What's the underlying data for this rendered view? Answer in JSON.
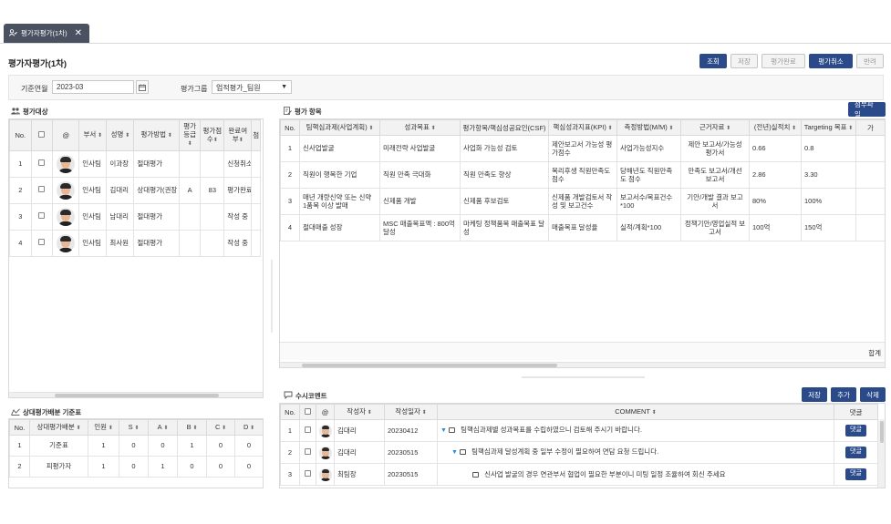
{
  "tab": {
    "label": "평가자평가(1차)",
    "close": "✕"
  },
  "page": {
    "title": "평가자평가(1차)"
  },
  "toolbar": {
    "search": "조회",
    "save": "저장",
    "complete": "평가완료",
    "cancel": "평가취소",
    "reject": "반려"
  },
  "filters": {
    "month_label": "기준연월",
    "month_value": "2023-03",
    "group_label": "평가그룹",
    "group_value": "업적평가_팀원"
  },
  "targets": {
    "title": "평가대상",
    "headers": [
      "No.",
      "",
      "@",
      "부서",
      "성명",
      "평가방법",
      "평가등급",
      "평가점수",
      "완료여부",
      "첨"
    ],
    "rows": [
      {
        "no": "1",
        "dept": "인사팀",
        "name": "이과장",
        "method": "절대평가",
        "grade": "",
        "score": "",
        "status": "신청취소"
      },
      {
        "no": "2",
        "dept": "인사팀",
        "name": "김대리",
        "method": "상대평가(권장",
        "grade": "A",
        "score": "83",
        "status": "평가완료"
      },
      {
        "no": "3",
        "dept": "인사팀",
        "name": "남대리",
        "method": "절대평가",
        "grade": "",
        "score": "",
        "status": "작성 중"
      },
      {
        "no": "4",
        "dept": "인사팀",
        "name": "최사원",
        "method": "절대평가",
        "grade": "",
        "score": "",
        "status": "작성 중"
      }
    ]
  },
  "items": {
    "title": "평가 항목",
    "attach": "첨부파일",
    "headers": [
      "No.",
      "팀핵심과제(사업계획)",
      "성과목표",
      "평가항목/핵심성공요인(CSF)",
      "핵심성과지표(KPI)",
      "측정방법(M/M)",
      "근거자료",
      "(전년)실적치",
      "Targeting 목표",
      "가"
    ],
    "rows": [
      {
        "no": "1",
        "task": "신사업발굴",
        "goal": "미래전략 사업발굴",
        "csf": "사업화 가능성 검토",
        "kpi": "제안보고서 가능성 평가점수",
        "method": "사업가능성지수",
        "evidence": "제안 보고서/가능성 평가서",
        "prev": "0.66",
        "target": "0.8"
      },
      {
        "no": "2",
        "task": "직원이 행복한 기업",
        "goal": "직원 만족 극대화",
        "csf": "직원 만족도 향상",
        "kpi": "복리후생 직원만족도 점수",
        "method": "당해년도 직원만족도 점수",
        "evidence": "만족도 보고서/개선 보고서",
        "prev": "2.86",
        "target": "3.30"
      },
      {
        "no": "3",
        "task": "매년 개량신약 또는 신약 1품목 이상 발매",
        "goal": "신제품 개발",
        "csf": "신제품 후보검토",
        "kpi": "신제품 개발검토서 작성 및 보고건수",
        "method": "보고서수/목표건수 *100",
        "evidence": "기안/개발 결과 보고서",
        "prev": "80%",
        "target": "100%"
      },
      {
        "no": "4",
        "task": "절대매출 성장",
        "goal": "MSC 매출목표액 : 800억 달성",
        "csf": "마케팅 정책품목 매출목표 달성",
        "kpi": "매출목표 달성율",
        "method": "실적/계획*100",
        "evidence": "정책기안/영업실적 보고서",
        "prev": "100억",
        "target": "150억"
      }
    ],
    "total_label": "합계"
  },
  "distribution": {
    "title": "상대평가배분 기준표",
    "headers": [
      "No.",
      "상대평가배분",
      "인원",
      "S",
      "A",
      "B",
      "C",
      "D"
    ],
    "rows": [
      {
        "no": "1",
        "name": "기준표",
        "count": "1",
        "s": "0",
        "a": "0",
        "b": "1",
        "c": "0",
        "d": "0"
      },
      {
        "no": "2",
        "name": "피평가자",
        "count": "1",
        "s": "0",
        "a": "1",
        "b": "0",
        "c": "0",
        "d": "0"
      }
    ]
  },
  "comments": {
    "title": "수시코멘트",
    "save": "저장",
    "add": "추가",
    "delete": "삭제",
    "headers": [
      "No.",
      "",
      "@",
      "작성자",
      "작성일자",
      "COMMENT",
      "댓글"
    ],
    "rows": [
      {
        "no": "1",
        "author": "김대리",
        "date": "20230412",
        "text": "팀핵심과제별 성과목표를 수립하였으니 검토해 주시기 바랍니다.",
        "reply": "댓글"
      },
      {
        "no": "2",
        "author": "김대리",
        "date": "20230515",
        "text": "팀핵심과제 달성계획 중 일부 수정이 필요하여 면담 요청 드립니다.",
        "reply": "댓글"
      },
      {
        "no": "3",
        "author": "최팀장",
        "date": "20230515",
        "text": "신사업 발굴의 경우 연관부서 협업이 필요한 부분이니 미팅 일정 조율하여 회신 주세요",
        "reply": "댓글"
      }
    ]
  },
  "colors": {
    "primary": "#2b4a8a",
    "tab_bg": "#4a5160",
    "header_bg": "#f2f2f2"
  }
}
